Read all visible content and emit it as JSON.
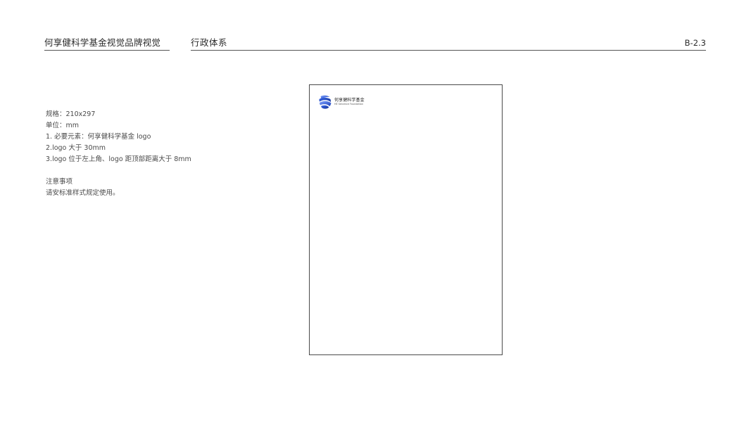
{
  "header": {
    "brand_title": "何享健科学基金视觉品牌视觉",
    "section_title": "行政体系",
    "page_code": "B-2.3"
  },
  "spec": {
    "lines": [
      "规格：210x297",
      "单位：mm",
      "1. 必要元素：何享健科学基金 logo",
      "2.logo 大于 30mm",
      "3.logo 位于左上角、logo 距顶部距离大于 8mm"
    ],
    "notes_title": "注意事项",
    "notes_text": "请安标准样式规定使用。"
  },
  "letterhead": {
    "logo_icon": "foundation-globe-icon",
    "logo_name": "何享健科学基金",
    "logo_subtitle": "HE Seicence Foundation",
    "logo_colors": [
      "#1a3fb8",
      "#3d6cf0",
      "#7fa2ff"
    ]
  }
}
